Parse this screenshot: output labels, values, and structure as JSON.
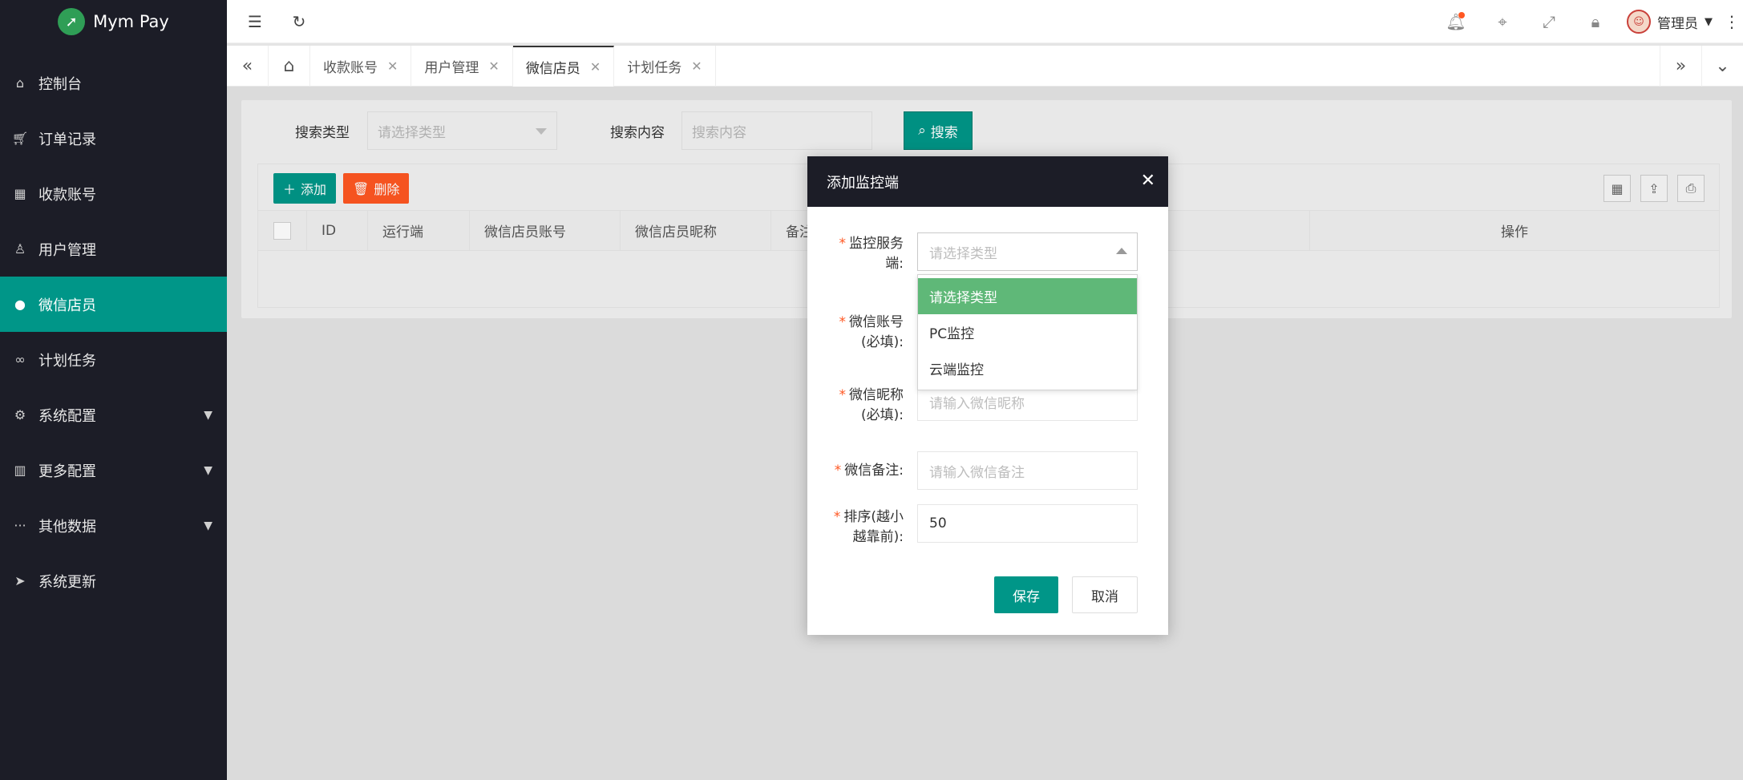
{
  "app": {
    "title": "Mym Pay",
    "logo_icon": "rocket-icon"
  },
  "sidebar": {
    "items": [
      {
        "label": "控制台",
        "icon": "home-icon"
      },
      {
        "label": "订单记录",
        "icon": "cart-icon"
      },
      {
        "label": "收款账号",
        "icon": "grid-icon"
      },
      {
        "label": "用户管理",
        "icon": "user-icon"
      },
      {
        "label": "微信店员",
        "icon": "wechat-icon",
        "active": true
      },
      {
        "label": "计划任务",
        "icon": "binoculars-icon"
      },
      {
        "label": "系统配置",
        "icon": "gear-icon",
        "expandable": true
      },
      {
        "label": "更多配置",
        "icon": "apps-icon",
        "expandable": true
      },
      {
        "label": "其他数据",
        "icon": "ellipsis-icon",
        "expandable": true
      },
      {
        "label": "系统更新",
        "icon": "send-icon"
      }
    ]
  },
  "header": {
    "user_name": "管理员",
    "icons": [
      "menu-fold-icon",
      "refresh-icon",
      "bell-icon",
      "tag-icon",
      "fullscreen-icon",
      "lock-icon",
      "more-icon"
    ]
  },
  "tabs": [
    {
      "label": "收款账号"
    },
    {
      "label": "用户管理"
    },
    {
      "label": "微信店员",
      "active": true
    },
    {
      "label": "计划任务"
    }
  ],
  "search": {
    "type_label": "搜索类型",
    "type_placeholder": "请选择类型",
    "content_label": "搜索内容",
    "content_placeholder": "搜索内容",
    "button_label": "搜索"
  },
  "toolbar": {
    "add_label": "添加",
    "delete_label": "删除"
  },
  "table": {
    "columns": [
      "ID",
      "运行端",
      "微信店员账号",
      "微信店员昵称",
      "备注",
      "操作"
    ]
  },
  "modal": {
    "title": "添加监控端",
    "fields": {
      "server": {
        "label_line1": "监控服务",
        "label_line2": "端:",
        "placeholder": "请选择类型"
      },
      "account": {
        "label_line1": "微信账号",
        "label_line2": "(必填):"
      },
      "nickname": {
        "label_line1": "微信昵称",
        "label_line2": "(必填):",
        "placeholder": "请输入微信昵称"
      },
      "remark": {
        "label": "微信备注:",
        "placeholder": "请输入微信备注"
      },
      "sort": {
        "label_line1": "排序(越小",
        "label_line2": "越靠前):",
        "value": "50"
      }
    },
    "dropdown_options": [
      "请选择类型",
      "PC监控",
      "云端监控"
    ],
    "save_label": "保存",
    "cancel_label": "取消"
  },
  "colors": {
    "primary": "#009688",
    "danger": "#ff5722",
    "sidebar_bg": "#1c1d27",
    "option_selected": "#5fb878"
  }
}
